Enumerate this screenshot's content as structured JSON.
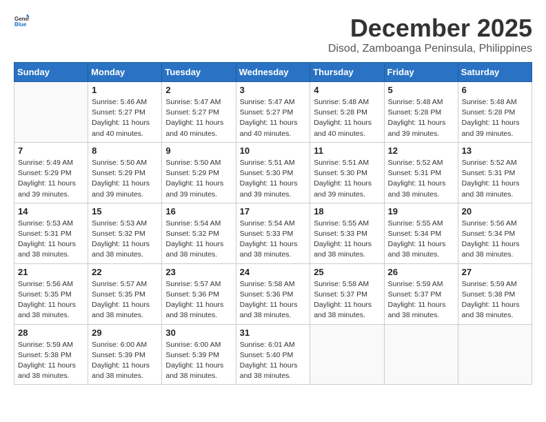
{
  "logo": {
    "general": "General",
    "blue": "Blue"
  },
  "title": "December 2025",
  "location": "Disod, Zamboanga Peninsula, Philippines",
  "weekdays": [
    "Sunday",
    "Monday",
    "Tuesday",
    "Wednesday",
    "Thursday",
    "Friday",
    "Saturday"
  ],
  "weeks": [
    [
      {
        "day": "",
        "info": ""
      },
      {
        "day": "1",
        "info": "Sunrise: 5:46 AM\nSunset: 5:27 PM\nDaylight: 11 hours\nand 40 minutes."
      },
      {
        "day": "2",
        "info": "Sunrise: 5:47 AM\nSunset: 5:27 PM\nDaylight: 11 hours\nand 40 minutes."
      },
      {
        "day": "3",
        "info": "Sunrise: 5:47 AM\nSunset: 5:27 PM\nDaylight: 11 hours\nand 40 minutes."
      },
      {
        "day": "4",
        "info": "Sunrise: 5:48 AM\nSunset: 5:28 PM\nDaylight: 11 hours\nand 40 minutes."
      },
      {
        "day": "5",
        "info": "Sunrise: 5:48 AM\nSunset: 5:28 PM\nDaylight: 11 hours\nand 39 minutes."
      },
      {
        "day": "6",
        "info": "Sunrise: 5:48 AM\nSunset: 5:28 PM\nDaylight: 11 hours\nand 39 minutes."
      }
    ],
    [
      {
        "day": "7",
        "info": "Sunrise: 5:49 AM\nSunset: 5:29 PM\nDaylight: 11 hours\nand 39 minutes."
      },
      {
        "day": "8",
        "info": "Sunrise: 5:50 AM\nSunset: 5:29 PM\nDaylight: 11 hours\nand 39 minutes."
      },
      {
        "day": "9",
        "info": "Sunrise: 5:50 AM\nSunset: 5:29 PM\nDaylight: 11 hours\nand 39 minutes."
      },
      {
        "day": "10",
        "info": "Sunrise: 5:51 AM\nSunset: 5:30 PM\nDaylight: 11 hours\nand 39 minutes."
      },
      {
        "day": "11",
        "info": "Sunrise: 5:51 AM\nSunset: 5:30 PM\nDaylight: 11 hours\nand 39 minutes."
      },
      {
        "day": "12",
        "info": "Sunrise: 5:52 AM\nSunset: 5:31 PM\nDaylight: 11 hours\nand 38 minutes."
      },
      {
        "day": "13",
        "info": "Sunrise: 5:52 AM\nSunset: 5:31 PM\nDaylight: 11 hours\nand 38 minutes."
      }
    ],
    [
      {
        "day": "14",
        "info": "Sunrise: 5:53 AM\nSunset: 5:31 PM\nDaylight: 11 hours\nand 38 minutes."
      },
      {
        "day": "15",
        "info": "Sunrise: 5:53 AM\nSunset: 5:32 PM\nDaylight: 11 hours\nand 38 minutes."
      },
      {
        "day": "16",
        "info": "Sunrise: 5:54 AM\nSunset: 5:32 PM\nDaylight: 11 hours\nand 38 minutes."
      },
      {
        "day": "17",
        "info": "Sunrise: 5:54 AM\nSunset: 5:33 PM\nDaylight: 11 hours\nand 38 minutes."
      },
      {
        "day": "18",
        "info": "Sunrise: 5:55 AM\nSunset: 5:33 PM\nDaylight: 11 hours\nand 38 minutes."
      },
      {
        "day": "19",
        "info": "Sunrise: 5:55 AM\nSunset: 5:34 PM\nDaylight: 11 hours\nand 38 minutes."
      },
      {
        "day": "20",
        "info": "Sunrise: 5:56 AM\nSunset: 5:34 PM\nDaylight: 11 hours\nand 38 minutes."
      }
    ],
    [
      {
        "day": "21",
        "info": "Sunrise: 5:56 AM\nSunset: 5:35 PM\nDaylight: 11 hours\nand 38 minutes."
      },
      {
        "day": "22",
        "info": "Sunrise: 5:57 AM\nSunset: 5:35 PM\nDaylight: 11 hours\nand 38 minutes."
      },
      {
        "day": "23",
        "info": "Sunrise: 5:57 AM\nSunset: 5:36 PM\nDaylight: 11 hours\nand 38 minutes."
      },
      {
        "day": "24",
        "info": "Sunrise: 5:58 AM\nSunset: 5:36 PM\nDaylight: 11 hours\nand 38 minutes."
      },
      {
        "day": "25",
        "info": "Sunrise: 5:58 AM\nSunset: 5:37 PM\nDaylight: 11 hours\nand 38 minutes."
      },
      {
        "day": "26",
        "info": "Sunrise: 5:59 AM\nSunset: 5:37 PM\nDaylight: 11 hours\nand 38 minutes."
      },
      {
        "day": "27",
        "info": "Sunrise: 5:59 AM\nSunset: 5:38 PM\nDaylight: 11 hours\nand 38 minutes."
      }
    ],
    [
      {
        "day": "28",
        "info": "Sunrise: 5:59 AM\nSunset: 5:38 PM\nDaylight: 11 hours\nand 38 minutes."
      },
      {
        "day": "29",
        "info": "Sunrise: 6:00 AM\nSunset: 5:39 PM\nDaylight: 11 hours\nand 38 minutes."
      },
      {
        "day": "30",
        "info": "Sunrise: 6:00 AM\nSunset: 5:39 PM\nDaylight: 11 hours\nand 38 minutes."
      },
      {
        "day": "31",
        "info": "Sunrise: 6:01 AM\nSunset: 5:40 PM\nDaylight: 11 hours\nand 38 minutes."
      },
      {
        "day": "",
        "info": ""
      },
      {
        "day": "",
        "info": ""
      },
      {
        "day": "",
        "info": ""
      }
    ]
  ]
}
